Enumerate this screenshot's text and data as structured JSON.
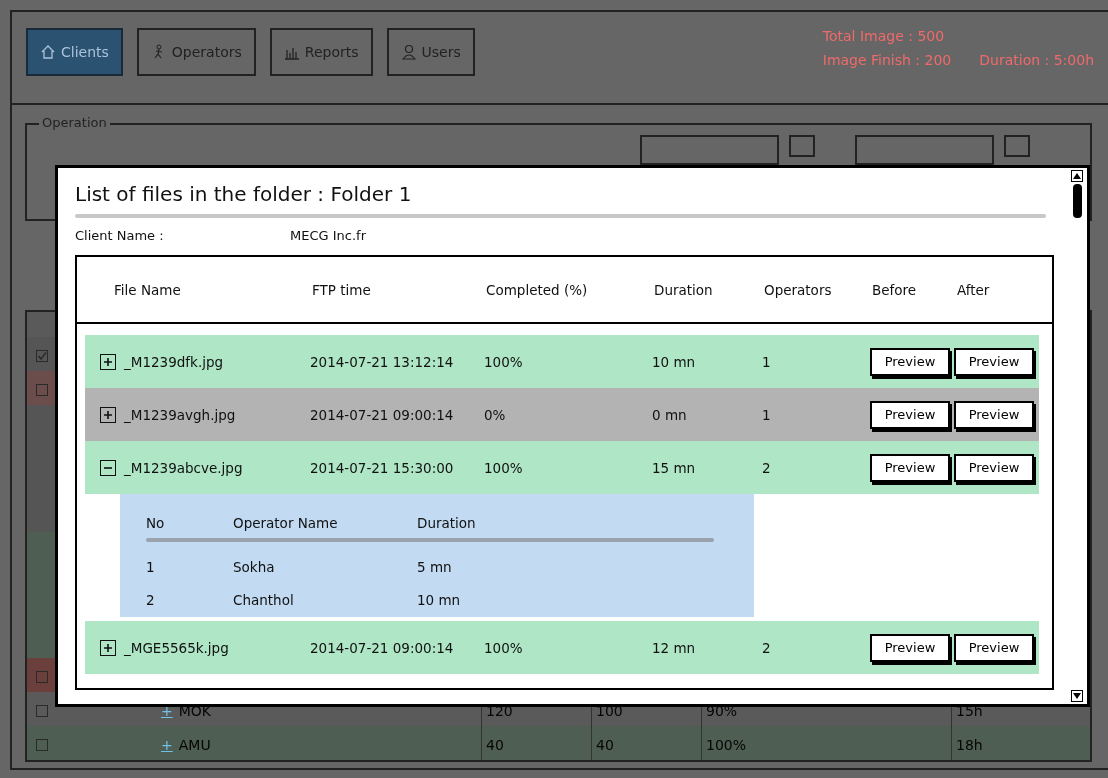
{
  "tabs": [
    {
      "label": "Clients",
      "selected": true
    },
    {
      "label": "Operators",
      "selected": false
    },
    {
      "label": "Reports",
      "selected": false
    },
    {
      "label": "Users",
      "selected": false
    }
  ],
  "stats": {
    "total_image": "Total Image : 500",
    "image_finish": "Image Finish : 200",
    "duration": "Duration : 5:00h"
  },
  "operation": {
    "legend": "Operation"
  },
  "background_table": {
    "rows": [
      {
        "kind": "row",
        "checked": true,
        "color": "#555555"
      },
      {
        "kind": "row",
        "checked": false,
        "color": "#6b4d4b"
      },
      {
        "kind": "detail",
        "color": "#555555"
      },
      {
        "kind": "detail",
        "color": "#4f5e53"
      },
      {
        "kind": "row",
        "checked": false,
        "color": "#6b403c"
      },
      {
        "kind": "row",
        "checked": false,
        "color": "#5a5a5a",
        "expander": "+",
        "cells": [
          "MOK",
          "120",
          "100",
          "90%",
          "15h"
        ]
      },
      {
        "kind": "row",
        "checked": false,
        "color": "#4f5e53",
        "expander": "+",
        "cells": [
          "AMU",
          "40",
          "40",
          "100%",
          "18h"
        ]
      }
    ]
  },
  "dialog": {
    "title": "List of files in the folder : Folder 1",
    "client_label": "Client Name :",
    "client_value": "MECG Inc.fr",
    "columns": [
      "File Name",
      "FTP time",
      "Completed (%)",
      "Duration",
      "Operators",
      "Before",
      "After"
    ],
    "files": [
      {
        "expanded": false,
        "color": "#aee6c6",
        "name": "_M1239dfk.jpg",
        "ftp_time": "2014-07-21 13:12:14",
        "completed": "100%",
        "duration": "10 mn",
        "operators": "1",
        "before": "Preview",
        "after": "Preview"
      },
      {
        "expanded": false,
        "color": "#b3b3b3",
        "name": "_M1239avgh.jpg",
        "ftp_time": "2014-07-21 09:00:14",
        "completed": "0%",
        "duration": "0 mn",
        "operators": "1",
        "before": "Preview",
        "after": "Preview"
      },
      {
        "expanded": true,
        "color": "#aee6c6",
        "name": "_M1239abcve.jpg",
        "ftp_time": "2014-07-21 15:30:00",
        "completed": "100%",
        "duration": "15 mn",
        "operators": "2",
        "before": "Preview",
        "after": "Preview",
        "detail": {
          "columns": [
            "No",
            "Operator Name",
            "Duration"
          ],
          "rows": [
            [
              "1",
              "Sokha",
              "5 mn"
            ],
            [
              "2",
              "Chanthol",
              "10 mn"
            ]
          ]
        }
      },
      {
        "expanded": false,
        "color": "#aee6c6",
        "name": "_MGE5565k.jpg",
        "ftp_time": "2014-07-21 09:00:14",
        "completed": "100%",
        "duration": "12 mn",
        "operators": "2",
        "before": "Preview",
        "after": "Preview"
      }
    ]
  }
}
